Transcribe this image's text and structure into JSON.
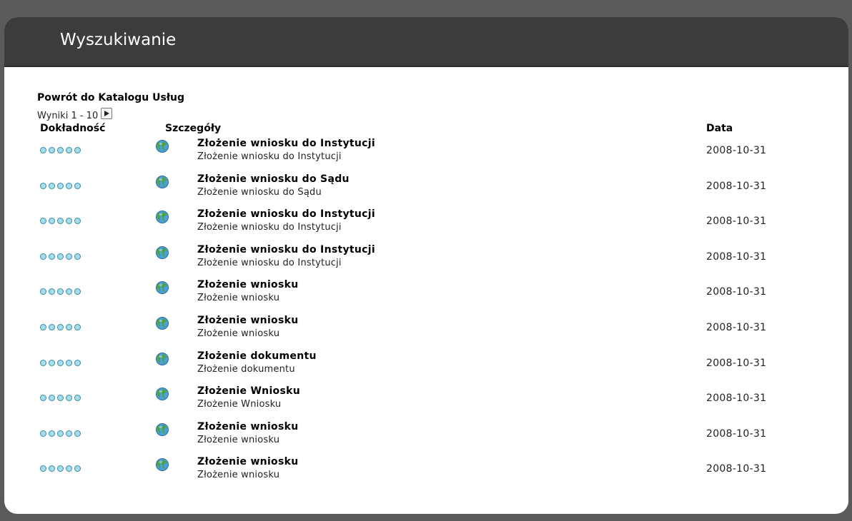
{
  "header": {
    "title": "Wyszukiwanie"
  },
  "back_link": "Powrót do Katalogu Usług",
  "results_label": "Wyniki 1 - 10",
  "columns": {
    "accuracy": "Dokładność",
    "details": "Szczegóły",
    "date": "Data"
  },
  "icons": {
    "next": "play-arrow-icon",
    "row_icon": "globe-icon",
    "rating": "dot-icon"
  },
  "colors": {
    "header_bg": "#3c3c3c",
    "dot_fill": "#a9dcea",
    "dot_border": "#2f8ea8"
  },
  "rows": [
    {
      "title": "Złożenie wniosku do Instytucji",
      "subtitle": "Złożenie wniosku do Instytucji",
      "date": "2008-10-31"
    },
    {
      "title": "Złożenie wniosku do Sądu",
      "subtitle": "Złożenie wniosku do Sądu",
      "date": "2008-10-31"
    },
    {
      "title": "Złożenie wniosku do Instytucji",
      "subtitle": "Złożenie wniosku do Instytucji",
      "date": "2008-10-31"
    },
    {
      "title": "Złożenie wniosku do Instytucji",
      "subtitle": "Złożenie wniosku do Instytucji",
      "date": "2008-10-31"
    },
    {
      "title": "Złożenie wniosku",
      "subtitle": "Złożenie wniosku",
      "date": "2008-10-31"
    },
    {
      "title": "Złożenie wniosku",
      "subtitle": "Złożenie wniosku",
      "date": "2008-10-31"
    },
    {
      "title": "Złożenie dokumentu",
      "subtitle": "Złożenie dokumentu",
      "date": "2008-10-31"
    },
    {
      "title": "Złożenie Wniosku",
      "subtitle": "Złożenie Wniosku",
      "date": "2008-10-31"
    },
    {
      "title": "Złożenie wniosku",
      "subtitle": "Złożenie wniosku",
      "date": "2008-10-31"
    },
    {
      "title": "Złożenie wniosku",
      "subtitle": "Złożenie wniosku",
      "date": "2008-10-31"
    }
  ]
}
